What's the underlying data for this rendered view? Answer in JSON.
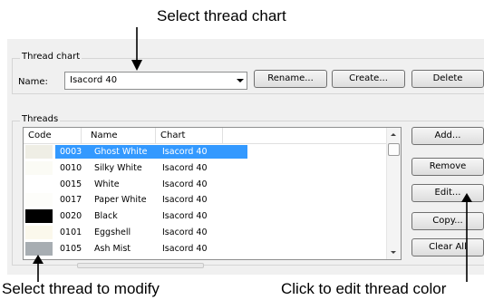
{
  "callouts": {
    "top": "Select thread chart",
    "bottom_left": "Select thread to modify",
    "bottom_right": "Click to edit thread color"
  },
  "thread_chart": {
    "legend": "Thread chart",
    "name_label": "Name:",
    "name_value": "Isacord 40",
    "buttons": {
      "rename": "Rename...",
      "create": "Create...",
      "delete": "Delete"
    }
  },
  "threads": {
    "legend": "Threads",
    "columns": {
      "code": "Code",
      "name": "Name",
      "chart": "Chart"
    },
    "rows": [
      {
        "code": "0003",
        "name": "Ghost White",
        "chart": "Isacord 40",
        "color": "#efeee5",
        "selected": true
      },
      {
        "code": "0010",
        "name": "Silky White",
        "chart": "Isacord 40",
        "color": "#fbfbf5",
        "selected": false
      },
      {
        "code": "0015",
        "name": "White",
        "chart": "Isacord 40",
        "color": "#ffffff",
        "selected": false
      },
      {
        "code": "0017",
        "name": "Paper White",
        "chart": "Isacord 40",
        "color": "#fdfdfa",
        "selected": false
      },
      {
        "code": "0020",
        "name": "Black",
        "chart": "Isacord 40",
        "color": "#000000",
        "selected": false
      },
      {
        "code": "0101",
        "name": "Eggshell",
        "chart": "Isacord 40",
        "color": "#fbf8ec",
        "selected": false
      },
      {
        "code": "0105",
        "name": "Ash Mist",
        "chart": "Isacord 40",
        "color": "#a7adb2",
        "selected": false
      }
    ],
    "buttons": {
      "add": "Add...",
      "remove": "Remove",
      "edit": "Edit...",
      "copy": "Copy...",
      "clear_all": "Clear All"
    }
  },
  "colors": {
    "selection": "#3399ff",
    "panel": "#f0f0f0"
  },
  "icons": {
    "combo_drop": "chevron-down-icon",
    "scroll_up": "scroll-up-icon",
    "scroll_down": "scroll-down-icon"
  }
}
